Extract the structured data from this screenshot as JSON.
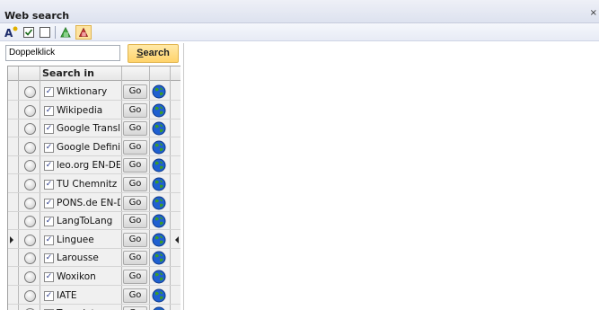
{
  "window": {
    "title": "Web search",
    "close_glyph": "×"
  },
  "toolbar": {
    "items": [
      {
        "icon": "font-settings-icon"
      },
      {
        "icon": "check-all-icon"
      },
      {
        "icon": "uncheck-all-icon"
      },
      {
        "icon": "add-bookmark-icon"
      },
      {
        "icon": "remove-bookmark-icon"
      }
    ]
  },
  "search": {
    "value": "Doppelklick",
    "button_label": "Search"
  },
  "grid": {
    "header": "Search in",
    "go_label": "Go",
    "check_glyph": "✓",
    "rows": [
      {
        "label": "Wiktionary",
        "checked": true,
        "current": false
      },
      {
        "label": "Wikipedia",
        "checked": true,
        "current": false
      },
      {
        "label": "Google Translator",
        "checked": true,
        "current": false
      },
      {
        "label": "Google Definition",
        "checked": true,
        "current": false
      },
      {
        "label": "leo.org EN-DE",
        "checked": true,
        "current": false
      },
      {
        "label": "TU Chemnitz - Di",
        "checked": true,
        "current": false
      },
      {
        "label": "PONS.de EN-DE",
        "checked": true,
        "current": false
      },
      {
        "label": "LangToLang",
        "checked": true,
        "current": false
      },
      {
        "label": "Linguee",
        "checked": true,
        "current": true
      },
      {
        "label": "Larousse",
        "checked": true,
        "current": false
      },
      {
        "label": "Woxikon",
        "checked": true,
        "current": false
      },
      {
        "label": "IATE",
        "checked": true,
        "current": false
      },
      {
        "label": "Termdat",
        "checked": true,
        "current": false
      }
    ]
  },
  "colors": {
    "search_button": "#ffd36a",
    "globe_blue": "#1f5fd1",
    "globe_green": "#3a9a2a"
  }
}
